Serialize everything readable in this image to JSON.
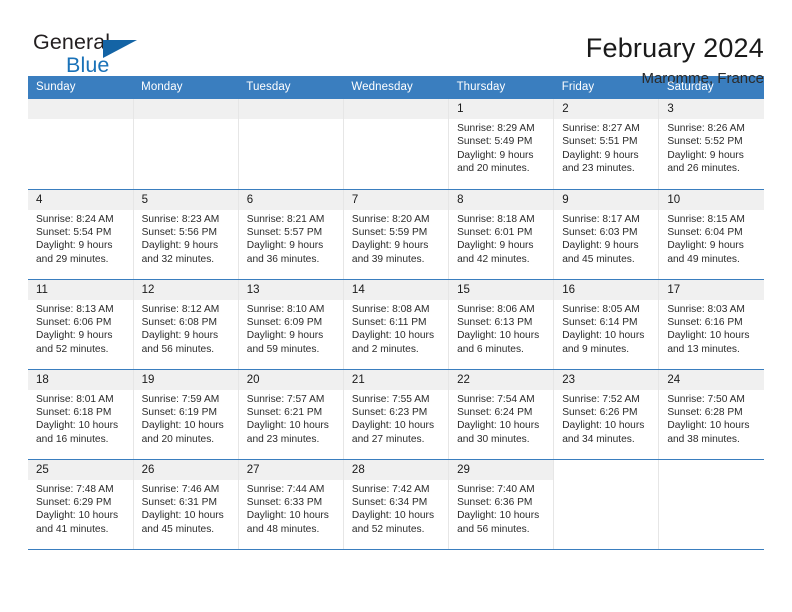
{
  "brand": {
    "name_part1": "General",
    "name_part2": "Blue",
    "triangle_color": "#1464a5",
    "blue_text_color": "#1a72b8"
  },
  "header": {
    "title": "February 2024",
    "location": "Maromme, France",
    "header_bg_color": "#3a7ebf",
    "daynum_bg_color": "#f0f0f0"
  },
  "weekdays": [
    "Sunday",
    "Monday",
    "Tuesday",
    "Wednesday",
    "Thursday",
    "Friday",
    "Saturday"
  ],
  "weeks": [
    [
      {
        "day": "",
        "blank": true
      },
      {
        "day": "",
        "blank": true
      },
      {
        "day": "",
        "blank": true
      },
      {
        "day": "",
        "blank": true
      },
      {
        "day": "1",
        "sunrise": "Sunrise: 8:29 AM",
        "sunset": "Sunset: 5:49 PM",
        "daylight1": "Daylight: 9 hours",
        "daylight2": "and 20 minutes."
      },
      {
        "day": "2",
        "sunrise": "Sunrise: 8:27 AM",
        "sunset": "Sunset: 5:51 PM",
        "daylight1": "Daylight: 9 hours",
        "daylight2": "and 23 minutes."
      },
      {
        "day": "3",
        "sunrise": "Sunrise: 8:26 AM",
        "sunset": "Sunset: 5:52 PM",
        "daylight1": "Daylight: 9 hours",
        "daylight2": "and 26 minutes."
      }
    ],
    [
      {
        "day": "4",
        "sunrise": "Sunrise: 8:24 AM",
        "sunset": "Sunset: 5:54 PM",
        "daylight1": "Daylight: 9 hours",
        "daylight2": "and 29 minutes."
      },
      {
        "day": "5",
        "sunrise": "Sunrise: 8:23 AM",
        "sunset": "Sunset: 5:56 PM",
        "daylight1": "Daylight: 9 hours",
        "daylight2": "and 32 minutes."
      },
      {
        "day": "6",
        "sunrise": "Sunrise: 8:21 AM",
        "sunset": "Sunset: 5:57 PM",
        "daylight1": "Daylight: 9 hours",
        "daylight2": "and 36 minutes."
      },
      {
        "day": "7",
        "sunrise": "Sunrise: 8:20 AM",
        "sunset": "Sunset: 5:59 PM",
        "daylight1": "Daylight: 9 hours",
        "daylight2": "and 39 minutes."
      },
      {
        "day": "8",
        "sunrise": "Sunrise: 8:18 AM",
        "sunset": "Sunset: 6:01 PM",
        "daylight1": "Daylight: 9 hours",
        "daylight2": "and 42 minutes."
      },
      {
        "day": "9",
        "sunrise": "Sunrise: 8:17 AM",
        "sunset": "Sunset: 6:03 PM",
        "daylight1": "Daylight: 9 hours",
        "daylight2": "and 45 minutes."
      },
      {
        "day": "10",
        "sunrise": "Sunrise: 8:15 AM",
        "sunset": "Sunset: 6:04 PM",
        "daylight1": "Daylight: 9 hours",
        "daylight2": "and 49 minutes."
      }
    ],
    [
      {
        "day": "11",
        "sunrise": "Sunrise: 8:13 AM",
        "sunset": "Sunset: 6:06 PM",
        "daylight1": "Daylight: 9 hours",
        "daylight2": "and 52 minutes."
      },
      {
        "day": "12",
        "sunrise": "Sunrise: 8:12 AM",
        "sunset": "Sunset: 6:08 PM",
        "daylight1": "Daylight: 9 hours",
        "daylight2": "and 56 minutes."
      },
      {
        "day": "13",
        "sunrise": "Sunrise: 8:10 AM",
        "sunset": "Sunset: 6:09 PM",
        "daylight1": "Daylight: 9 hours",
        "daylight2": "and 59 minutes."
      },
      {
        "day": "14",
        "sunrise": "Sunrise: 8:08 AM",
        "sunset": "Sunset: 6:11 PM",
        "daylight1": "Daylight: 10 hours",
        "daylight2": "and 2 minutes."
      },
      {
        "day": "15",
        "sunrise": "Sunrise: 8:06 AM",
        "sunset": "Sunset: 6:13 PM",
        "daylight1": "Daylight: 10 hours",
        "daylight2": "and 6 minutes."
      },
      {
        "day": "16",
        "sunrise": "Sunrise: 8:05 AM",
        "sunset": "Sunset: 6:14 PM",
        "daylight1": "Daylight: 10 hours",
        "daylight2": "and 9 minutes."
      },
      {
        "day": "17",
        "sunrise": "Sunrise: 8:03 AM",
        "sunset": "Sunset: 6:16 PM",
        "daylight1": "Daylight: 10 hours",
        "daylight2": "and 13 minutes."
      }
    ],
    [
      {
        "day": "18",
        "sunrise": "Sunrise: 8:01 AM",
        "sunset": "Sunset: 6:18 PM",
        "daylight1": "Daylight: 10 hours",
        "daylight2": "and 16 minutes."
      },
      {
        "day": "19",
        "sunrise": "Sunrise: 7:59 AM",
        "sunset": "Sunset: 6:19 PM",
        "daylight1": "Daylight: 10 hours",
        "daylight2": "and 20 minutes."
      },
      {
        "day": "20",
        "sunrise": "Sunrise: 7:57 AM",
        "sunset": "Sunset: 6:21 PM",
        "daylight1": "Daylight: 10 hours",
        "daylight2": "and 23 minutes."
      },
      {
        "day": "21",
        "sunrise": "Sunrise: 7:55 AM",
        "sunset": "Sunset: 6:23 PM",
        "daylight1": "Daylight: 10 hours",
        "daylight2": "and 27 minutes."
      },
      {
        "day": "22",
        "sunrise": "Sunrise: 7:54 AM",
        "sunset": "Sunset: 6:24 PM",
        "daylight1": "Daylight: 10 hours",
        "daylight2": "and 30 minutes."
      },
      {
        "day": "23",
        "sunrise": "Sunrise: 7:52 AM",
        "sunset": "Sunset: 6:26 PM",
        "daylight1": "Daylight: 10 hours",
        "daylight2": "and 34 minutes."
      },
      {
        "day": "24",
        "sunrise": "Sunrise: 7:50 AM",
        "sunset": "Sunset: 6:28 PM",
        "daylight1": "Daylight: 10 hours",
        "daylight2": "and 38 minutes."
      }
    ],
    [
      {
        "day": "25",
        "sunrise": "Sunrise: 7:48 AM",
        "sunset": "Sunset: 6:29 PM",
        "daylight1": "Daylight: 10 hours",
        "daylight2": "and 41 minutes."
      },
      {
        "day": "26",
        "sunrise": "Sunrise: 7:46 AM",
        "sunset": "Sunset: 6:31 PM",
        "daylight1": "Daylight: 10 hours",
        "daylight2": "and 45 minutes."
      },
      {
        "day": "27",
        "sunrise": "Sunrise: 7:44 AM",
        "sunset": "Sunset: 6:33 PM",
        "daylight1": "Daylight: 10 hours",
        "daylight2": "and 48 minutes."
      },
      {
        "day": "28",
        "sunrise": "Sunrise: 7:42 AM",
        "sunset": "Sunset: 6:34 PM",
        "daylight1": "Daylight: 10 hours",
        "daylight2": "and 52 minutes."
      },
      {
        "day": "29",
        "sunrise": "Sunrise: 7:40 AM",
        "sunset": "Sunset: 6:36 PM",
        "daylight1": "Daylight: 10 hours",
        "daylight2": "and 56 minutes."
      },
      {
        "day": "",
        "blank": true
      },
      {
        "day": "",
        "blank": true
      }
    ]
  ]
}
